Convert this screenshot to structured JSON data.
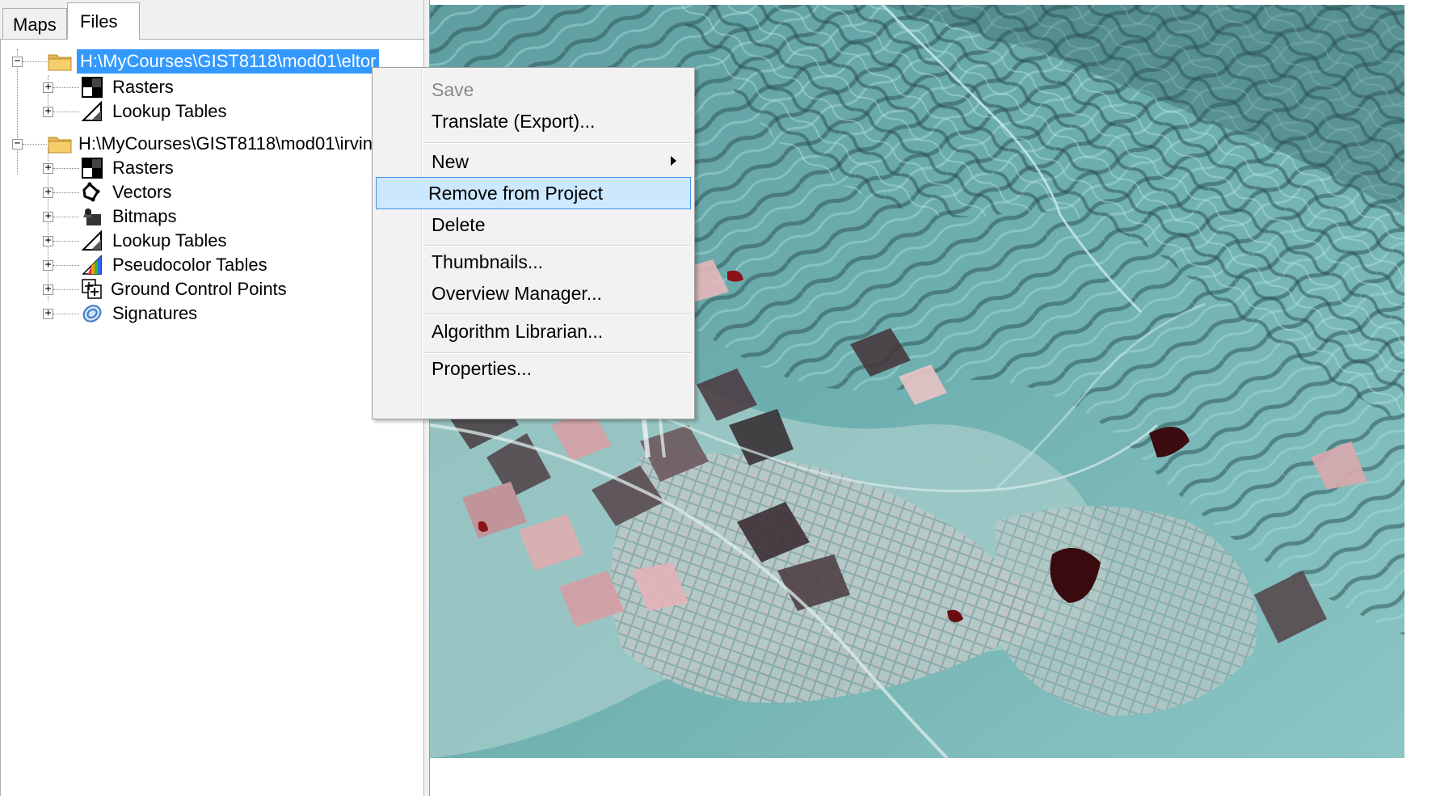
{
  "tabs": {
    "maps": "Maps",
    "files": "Files"
  },
  "tree": {
    "roots": [
      {
        "label": "H:\\MyCourses\\GIST8118\\mod01\\eltor",
        "selected": true,
        "children": [
          {
            "label": "Rasters",
            "icon": "raster-icon"
          },
          {
            "label": "Lookup Tables",
            "icon": "lookup-table-icon"
          }
        ]
      },
      {
        "label": "H:\\MyCourses\\GIST8118\\mod01\\irvin",
        "selected": false,
        "children": [
          {
            "label": "Rasters",
            "icon": "raster-icon"
          },
          {
            "label": "Vectors",
            "icon": "vector-icon"
          },
          {
            "label": "Bitmaps",
            "icon": "bitmap-icon"
          },
          {
            "label": "Lookup Tables",
            "icon": "lookup-table-icon"
          },
          {
            "label": "Pseudocolor Tables",
            "icon": "pseudocolor-table-icon"
          },
          {
            "label": "Ground Control Points",
            "icon": "gcp-icon"
          },
          {
            "label": "Signatures",
            "icon": "signature-icon"
          }
        ]
      }
    ]
  },
  "context_menu": {
    "items": [
      {
        "label": "Save",
        "disabled": true
      },
      {
        "label": "Translate (Export)..."
      },
      {
        "label": "New",
        "submenu": true
      },
      {
        "label": "Remove from Project",
        "highlighted": true
      },
      {
        "label": "Delete"
      },
      {
        "label": "Thumbnails..."
      },
      {
        "label": "Overview Manager..."
      },
      {
        "label": "Algorithm Librarian..."
      },
      {
        "label": "Properties..."
      }
    ]
  },
  "colors": {
    "selection": "#3399ff",
    "menu_highlight": "#cce8ff",
    "menu_highlight_border": "#3f8fe6",
    "image_cyan": "#7fbcbc",
    "image_dark": "#2d4f52",
    "image_pink": "#d99aa0"
  }
}
